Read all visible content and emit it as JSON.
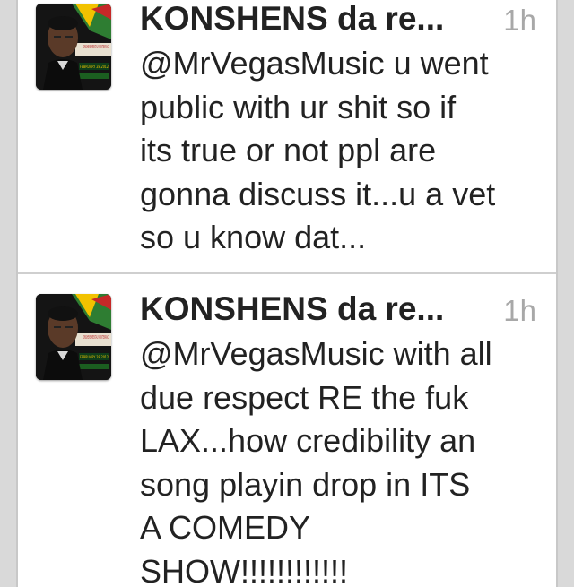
{
  "colors": {
    "background": "#ffffff",
    "name": "#222222",
    "text": "#222222",
    "time": "#a8a8a8",
    "divider": "#cfcfcf"
  },
  "tweets": [
    {
      "author": "KONSHENS da re...",
      "time": "1h",
      "avatar_icon": "user-avatar-photo",
      "avatar_caption": "KONSHENS MENTAL MAINTENANCE",
      "avatar_date": "FEBRUARY 28,2012",
      "lines": [
        "@MrVegasMusic u went",
        "public with ur shit so if",
        "its true or not ppl are",
        "gonna discuss it...u a vet",
        "so u know dat..."
      ]
    },
    {
      "author": "KONSHENS da re...",
      "time": "1h",
      "avatar_icon": "user-avatar-photo",
      "avatar_caption": "KONSHENS MENTAL MAINTENANCE",
      "avatar_date": "FEBRUARY 28,2012",
      "lines": [
        "@MrVegasMusic with all",
        "due respect RE the fuk",
        "LAX...how credibility an",
        "song playin drop in ITS",
        "A COMEDY",
        "SHOW!!!!!!!!!!!!"
      ]
    }
  ]
}
